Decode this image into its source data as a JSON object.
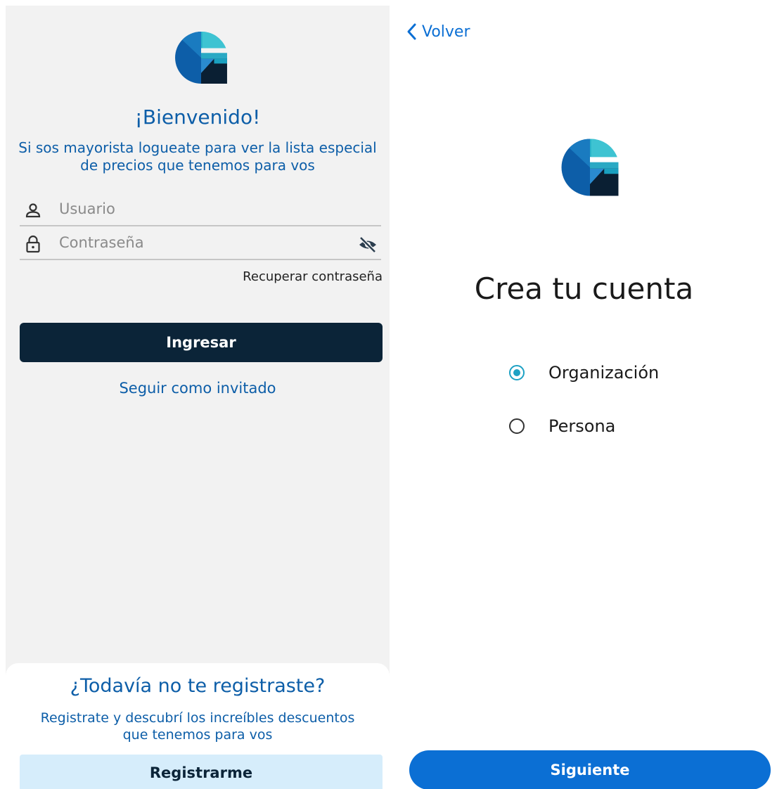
{
  "login": {
    "logo_icon": "brand-g-logo",
    "title": "¡Bienvenido!",
    "subtitle_line1": "Si sos mayorista logueate para ver la lista especial",
    "subtitle_line2": "de precios que tenemos para vos",
    "username_placeholder": "Usuario",
    "username_icon": "person-icon",
    "password_placeholder": "Contraseña",
    "password_icon": "lock-icon",
    "toggle_visibility_icon": "eye-off-icon",
    "recover_label": "Recuperar contraseña",
    "login_button": "Ingresar",
    "guest_link": "Seguir como invitado",
    "register_title": "¿Todavía no te registraste?",
    "register_sub_line1": "Registrate y descubrí los increíbles descuentos",
    "register_sub_line2": "que tenemos para vos",
    "register_button": "Registrarme"
  },
  "signup": {
    "back_label": "Volver",
    "back_icon": "chevron-left-icon",
    "logo_icon": "brand-g-logo",
    "title": "Crea tu cuenta",
    "options": [
      {
        "label": "Organización",
        "selected": true
      },
      {
        "label": "Persona",
        "selected": false
      }
    ],
    "next_button": "Siguiente"
  },
  "colors": {
    "brand_blue": "#0d5ea8",
    "navy_button": "#0b2438",
    "accent_teal": "#1da1c4",
    "primary_blue": "#0b6fd4",
    "register_button_bg": "#d6edfb",
    "screen_bg": "#f2f2f2"
  }
}
